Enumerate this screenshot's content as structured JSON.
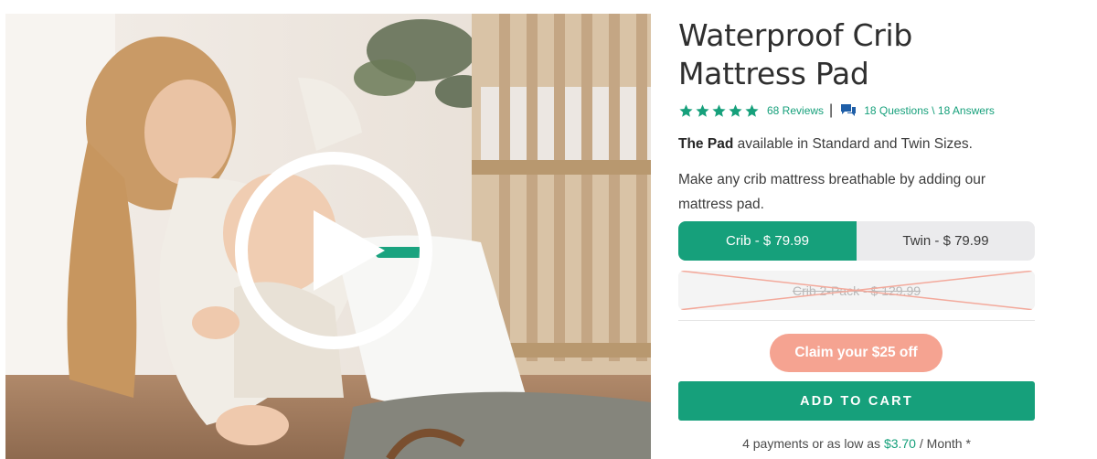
{
  "product": {
    "title_line1": "Waterproof Crib",
    "title_line2": "Mattress Pad",
    "rating_stars": 5,
    "reviews_label": "68 Reviews",
    "separator": "|",
    "qa_label": "18 Questions \\ 18 Answers",
    "availability_bold": "The Pad",
    "availability_rest": " available in Standard and Twin Sizes.",
    "description": "Make any crib mattress breathable by adding our mattress pad."
  },
  "sizes": [
    {
      "label": "Crib - $ 79.99",
      "selected": true
    },
    {
      "label": "Twin - $ 79.99",
      "selected": false
    }
  ],
  "pack_option": {
    "label": "Crib 2-Pack - $ 129.99",
    "unavailable": true
  },
  "promo": {
    "claim_label": "Claim your $25 off"
  },
  "cart": {
    "add_label": "ADD TO CART"
  },
  "payments": {
    "prefix": "4 payments or as low as ",
    "amount": "$3.70",
    "suffix": " / Month *"
  },
  "colors": {
    "accent": "#16a07b",
    "promo": "#f5a391",
    "toggle_bg": "#ebebed"
  },
  "icons": {
    "rating": "star-icon",
    "qa": "chat-bubbles-icon",
    "video": "play-icon"
  }
}
